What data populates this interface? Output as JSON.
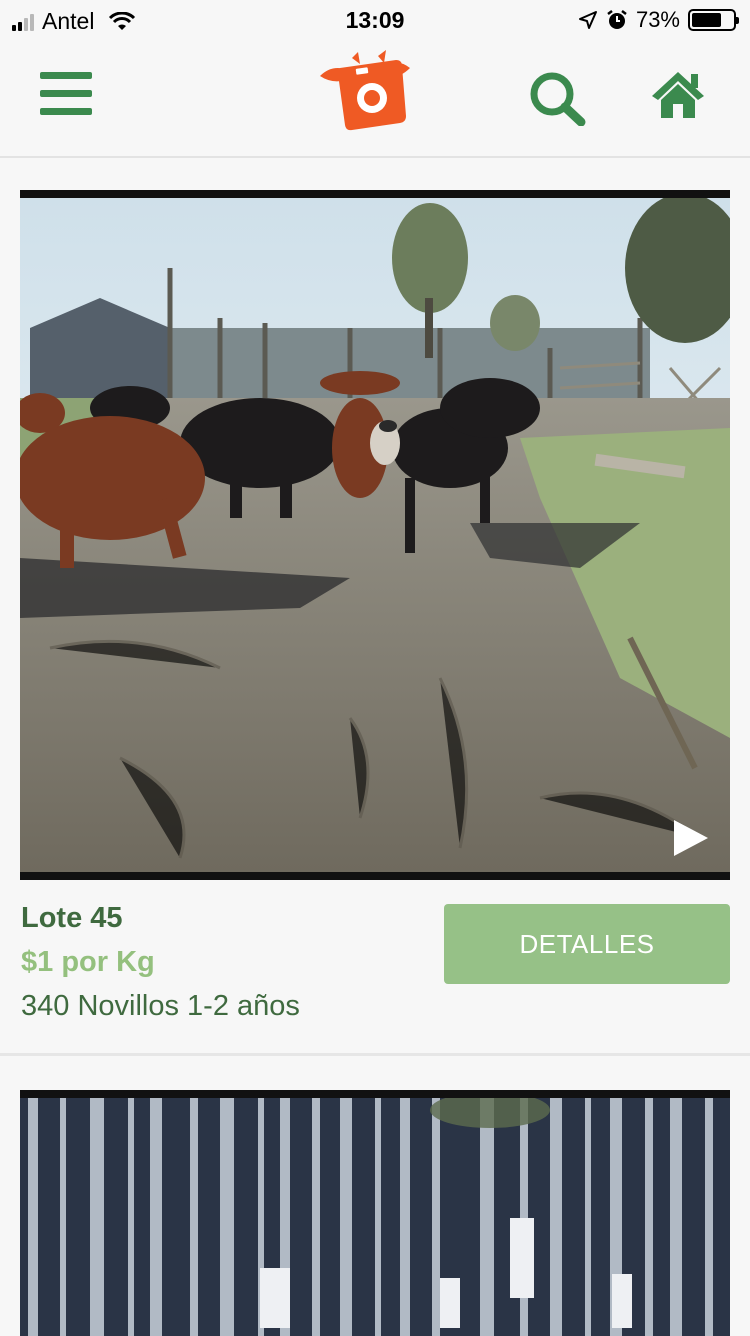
{
  "status": {
    "carrier": "Antel",
    "time": "13:09",
    "battery": "73%",
    "battery_level": 0.73,
    "signal_bars": 4,
    "signal_active": 2
  },
  "nav": {
    "icons": [
      "menu-icon",
      "cow-camera-logo",
      "search-icon",
      "home-icon"
    ],
    "colors": {
      "green": "#3b8a4e",
      "orange": "#ef5a24"
    }
  },
  "lots": [
    {
      "title": "Lote 45",
      "price": "$1 por Kg",
      "description": "340 Novillos 1-2 años",
      "button_label": "DETALLES",
      "media": "video-thumbnail-cattle"
    },
    {
      "media": "video-thumbnail-forest"
    }
  ],
  "colors": {
    "title": "#3f6a3f",
    "price": "#94c07e",
    "button": "#96c187",
    "background": "#f7f7f7"
  }
}
